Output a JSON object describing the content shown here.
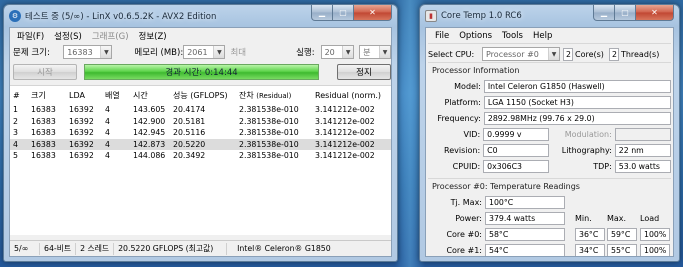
{
  "linx": {
    "title": "테스트 중 (5/∞) - LinX v0.6.5.2K - AVX2 Edition",
    "menu": [
      "파일(F)",
      "설정(S)",
      "그래프(G)",
      "정보(Z)"
    ],
    "problem_size_label": "문제 크기:",
    "problem_size_value": "16383",
    "memory_label": "메모리 (MB):",
    "memory_value": "2061",
    "max_label": "최대",
    "runs_label": "실행:",
    "runs_value": "20",
    "runs_unit": "분",
    "start_label": "시작",
    "elapsed_label": "경과 시간: 0:14:44",
    "stop_label": "정지",
    "columns": [
      "#",
      "크기",
      "LDA",
      "배열",
      "시간",
      "성능 (GFLOPS)",
      "잔차",
      "잔차 (Residual)",
      "Residual (norm.)"
    ],
    "rows": [
      [
        "1",
        "16383",
        "16392",
        "4",
        "143.605",
        "20.4174",
        "2.381538e-010",
        "3.141212e-002"
      ],
      [
        "2",
        "16383",
        "16392",
        "4",
        "142.900",
        "20.5181",
        "2.381538e-010",
        "3.141212e-002"
      ],
      [
        "3",
        "16383",
        "16392",
        "4",
        "142.945",
        "20.5116",
        "2.381538e-010",
        "3.141212e-002"
      ],
      [
        "4",
        "16383",
        "16392",
        "4",
        "142.873",
        "20.5220",
        "2.381538e-010",
        "3.141212e-002"
      ],
      [
        "5",
        "16383",
        "16392",
        "4",
        "144.086",
        "20.3492",
        "2.381538e-010",
        "3.141212e-002"
      ]
    ],
    "selected_row": 3,
    "status": [
      "5/∞",
      "64-비트",
      "2 스레드",
      "20.5220 GFLOPS (최고값)",
      "Intel® Celeron® G1850"
    ]
  },
  "coretemp": {
    "title": "Core Temp 1.0 RC6",
    "menu": [
      "File",
      "Options",
      "Tools",
      "Help"
    ],
    "select_cpu_label": "Select CPU:",
    "processor_value": "Processor #0",
    "cores_value": "2",
    "cores_label": "Core(s)",
    "threads_value": "2",
    "threads_label": "Thread(s)",
    "proc_info_title": "Processor Information",
    "model_label": "Model:",
    "model_value": "Intel Celeron G1850 (Haswell)",
    "platform_label": "Platform:",
    "platform_value": "LGA 1150 (Socket H3)",
    "frequency_label": "Frequency:",
    "frequency_value": "2892.98MHz (99.76 x 29.0)",
    "vid_label": "VID:",
    "vid_value": "0.9999 v",
    "modulation_label": "Modulation:",
    "revision_label": "Revision:",
    "revision_value": "C0",
    "lithography_label": "Lithography:",
    "lithography_value": "22 nm",
    "cpuid_label": "CPUID:",
    "cpuid_value": "0x306C3",
    "tdp_label": "TDP:",
    "tdp_value": "53.0 watts",
    "temps_title": "Processor #0: Temperature Readings",
    "tjmax_label": "Tj. Max:",
    "tjmax_value": "100°C",
    "power_label": "Power:",
    "power_value": "379.4 watts",
    "col_min": "Min.",
    "col_max": "Max.",
    "col_load": "Load",
    "cores": [
      {
        "label": "Core #0:",
        "temp": "58°C",
        "min": "36°C",
        "max": "59°C",
        "load": "100%"
      },
      {
        "label": "Core #1:",
        "temp": "54°C",
        "min": "34°C",
        "max": "55°C",
        "load": "100%"
      }
    ]
  },
  "colors": {
    "progress_green": "#5fd44c",
    "close_red": "#c04632",
    "desktop_blue": "#3f82bf"
  }
}
